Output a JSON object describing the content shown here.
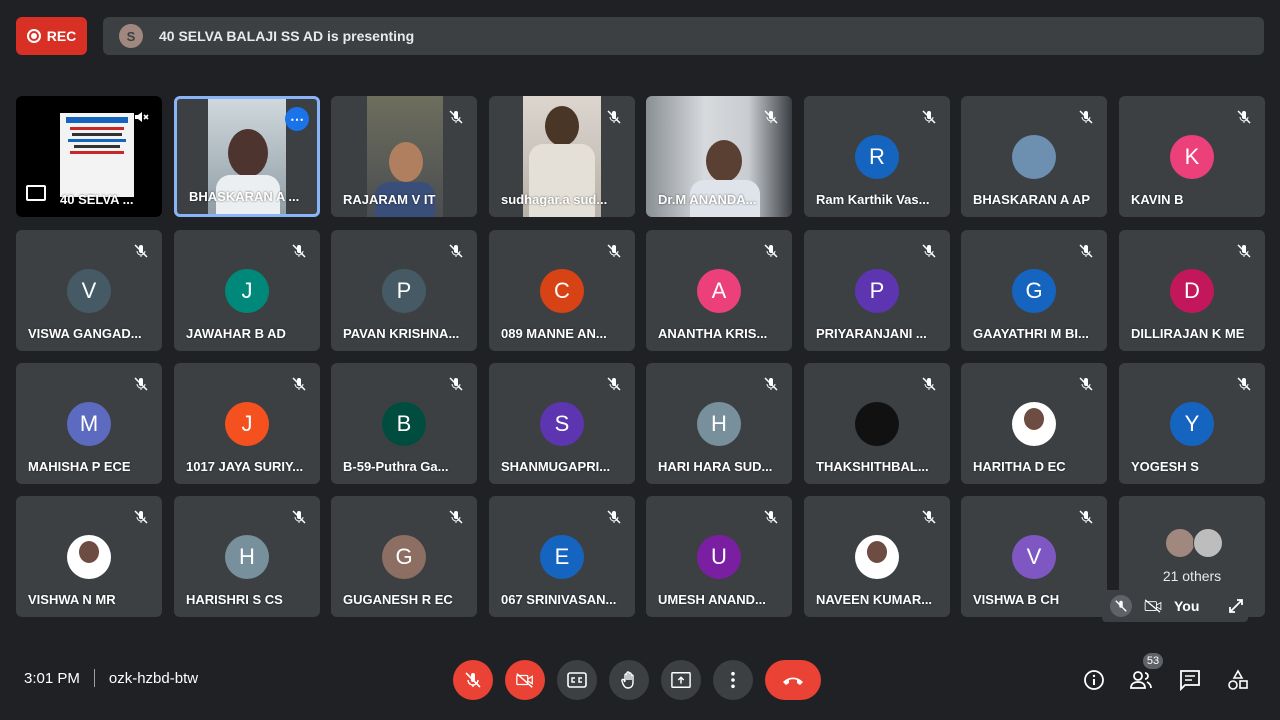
{
  "recording": {
    "label": "REC"
  },
  "presenter": {
    "initial": "S",
    "text": "40 SELVA BALAJI SS AD is presenting"
  },
  "colors": {
    "background": "#202124",
    "tile": "#3c4043",
    "danger": "#ea4335",
    "highlight": "#8ab4f8"
  },
  "video_tiles": [
    {
      "name": "40 SELVA ..."
    },
    {
      "name": "BHASKARAN A ..."
    },
    {
      "name": "RAJARAM V IT"
    },
    {
      "name": "sudhagar.a sud..."
    },
    {
      "name": "Dr.M ANANDA..."
    }
  ],
  "participants": [
    {
      "name": "Ram Karthik Vas...",
      "initial": "R",
      "color": "#1565c0"
    },
    {
      "name": "BHASKARAN A AP",
      "initial": "",
      "color": "#6d8fb0"
    },
    {
      "name": "KAVIN B",
      "initial": "K",
      "color": "#ec407a"
    },
    {
      "name": "VISWA GANGAD...",
      "initial": "V",
      "color": "#455a64"
    },
    {
      "name": "JAWAHAR B AD",
      "initial": "J",
      "color": "#00897b"
    },
    {
      "name": "PAVAN KRISHNA...",
      "initial": "P",
      "color": "#455a64"
    },
    {
      "name": "089 MANNE AN...",
      "initial": "C",
      "color": "#d84315"
    },
    {
      "name": "ANANTHA KRIS...",
      "initial": "A",
      "color": "#ec407a"
    },
    {
      "name": "PRIYARANJANI ...",
      "initial": "P",
      "color": "#5e35b1"
    },
    {
      "name": "GAAYATHRI M BI...",
      "initial": "G",
      "color": "#1565c0"
    },
    {
      "name": "DILLIRAJAN K ME",
      "initial": "D",
      "color": "#c2185b"
    },
    {
      "name": "MAHISHA P ECE",
      "initial": "M",
      "color": "#5c6bc0"
    },
    {
      "name": "1017 JAYA SURIY...",
      "initial": "J",
      "color": "#f4511e"
    },
    {
      "name": "B-59-Puthra Ga...",
      "initial": "B",
      "color": "#004d40"
    },
    {
      "name": "SHANMUGAPRI...",
      "initial": "S",
      "color": "#5e35b1"
    },
    {
      "name": "HARI HARA SUD...",
      "initial": "H",
      "color": "#78909c"
    },
    {
      "name": "THAKSHITHBAL...",
      "initial": "",
      "color": "#111111"
    },
    {
      "name": "HARITHA D EC",
      "initial": "",
      "color": "#ffffff"
    },
    {
      "name": "YOGESH S",
      "initial": "Y",
      "color": "#1565c0"
    },
    {
      "name": "VISHWA N MR",
      "initial": "",
      "color": "#ffffff"
    },
    {
      "name": "HARISHRI S CS",
      "initial": "H",
      "color": "#78909c"
    },
    {
      "name": "GUGANESH R EC",
      "initial": "G",
      "color": "#8d6e63"
    },
    {
      "name": "067 SRINIVASAN...",
      "initial": "E",
      "color": "#1565c0"
    },
    {
      "name": "UMESH ANAND...",
      "initial": "U",
      "color": "#7b1fa2"
    },
    {
      "name": "NAVEEN KUMAR...",
      "initial": "",
      "color": "#ffffff"
    },
    {
      "name": "VISHWA B CH",
      "initial": "V",
      "color": "#7e57c2"
    }
  ],
  "others": {
    "label": "21 others"
  },
  "self_view": {
    "label": "You"
  },
  "meeting": {
    "time": "3:01 PM",
    "code": "ozk-hzbd-btw"
  },
  "people_count": "53"
}
